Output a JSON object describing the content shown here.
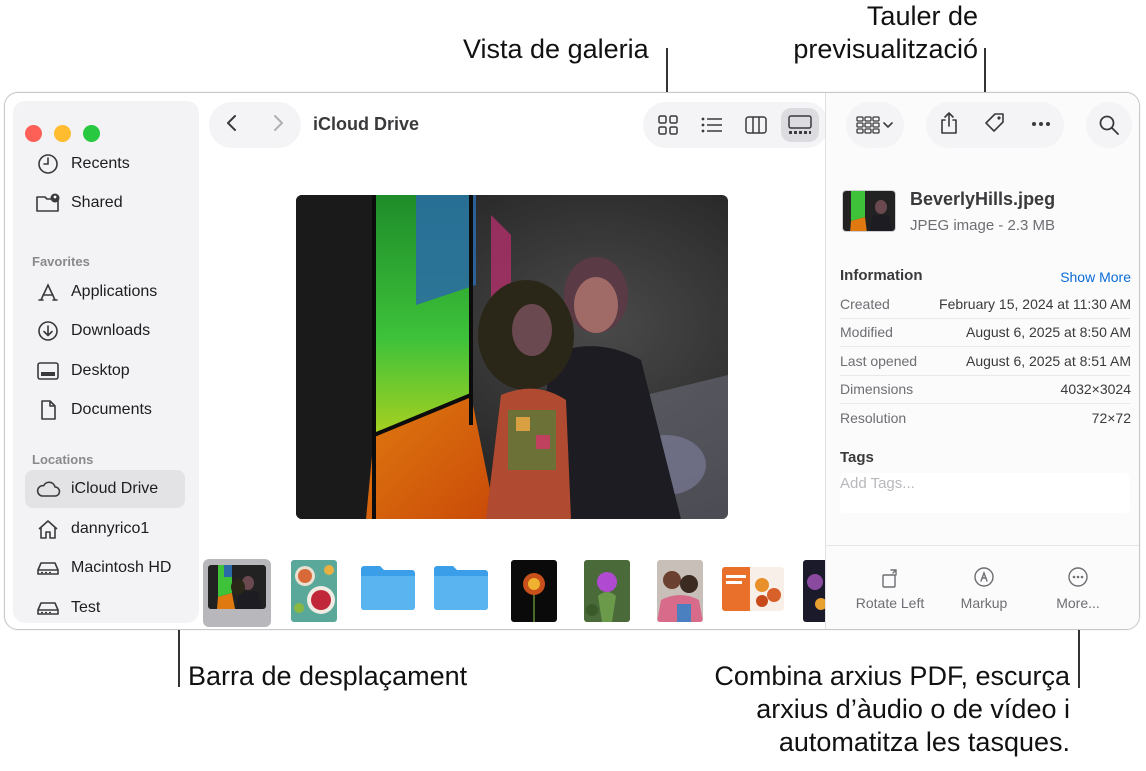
{
  "callouts": {
    "gallery_view": "Vista de galeria",
    "preview_pane_line1": "Tauler de",
    "preview_pane_line2": "previsualització",
    "scrubber_bar": "Barra de desplaçament",
    "quick_actions_line1": "Combina arxius PDF, escurça",
    "quick_actions_line2": "arxius d’àudio o de vídeo i",
    "quick_actions_line3": "automatitza les tasques."
  },
  "window": {
    "title": "iCloud Drive"
  },
  "sidebar": {
    "top_items": [
      {
        "label": "Recents",
        "icon": "clock-icon"
      },
      {
        "label": "Shared",
        "icon": "shared-folder-icon"
      }
    ],
    "favorites_heading": "Favorites",
    "favorites": [
      {
        "label": "Applications",
        "icon": "applications-icon"
      },
      {
        "label": "Downloads",
        "icon": "downloads-icon"
      },
      {
        "label": "Desktop",
        "icon": "desktop-icon"
      },
      {
        "label": "Documents",
        "icon": "document-icon"
      }
    ],
    "locations_heading": "Locations",
    "locations": [
      {
        "label": "iCloud Drive",
        "icon": "cloud-icon",
        "selected": true
      },
      {
        "label": "dannyrico1",
        "icon": "home-icon"
      },
      {
        "label": "Macintosh HD",
        "icon": "disk-icon"
      },
      {
        "label": "Test",
        "icon": "disk-icon"
      }
    ]
  },
  "preview": {
    "filename": "BeverlyHills.jpeg",
    "kind_size": "JPEG image - 2.3 MB",
    "information_heading": "Information",
    "show_more": "Show More",
    "rows": [
      {
        "label": "Created",
        "value": "February 15, 2024 at 11:30 AM"
      },
      {
        "label": "Modified",
        "value": "August 6, 2025 at 8:50 AM"
      },
      {
        "label": "Last opened",
        "value": "August 6, 2025 at 8:51 AM"
      },
      {
        "label": "Dimensions",
        "value": "4032×3024"
      },
      {
        "label": "Resolution",
        "value": "72×72"
      }
    ],
    "tags_heading": "Tags",
    "tags_placeholder": "Add Tags...",
    "actions": [
      {
        "label": "Rotate Left",
        "icon": "rotate-left-icon"
      },
      {
        "label": "Markup",
        "icon": "markup-icon"
      },
      {
        "label": "More...",
        "icon": "more-icon"
      }
    ]
  },
  "colors": {
    "accent": "#0a6cd8",
    "close": "#fe5f57",
    "minimize": "#febc2e",
    "zoom": "#28c840",
    "folder": "#5ab4f0"
  }
}
